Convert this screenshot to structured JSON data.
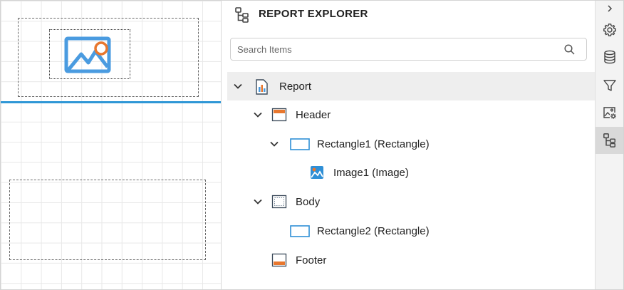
{
  "explorer": {
    "title": "REPORT EXPLORER",
    "search_placeholder": "Search Items",
    "tree": [
      {
        "label": "Report",
        "icon": "report-icon",
        "expanded": true,
        "selected": true
      },
      {
        "label": "Header",
        "icon": "header-band-icon",
        "expanded": true
      },
      {
        "label": "Rectangle1 (Rectangle)",
        "icon": "rectangle-icon",
        "expanded": true
      },
      {
        "label": "Image1 (Image)",
        "icon": "image-icon"
      },
      {
        "label": "Body",
        "icon": "body-band-icon",
        "expanded": true
      },
      {
        "label": "Rectangle2 (Rectangle)",
        "icon": "rectangle-icon"
      },
      {
        "label": "Footer",
        "icon": "footer-band-icon"
      }
    ]
  },
  "toolbar": {
    "items": [
      {
        "icon": "chevron-right-icon"
      },
      {
        "icon": "gear-icon"
      },
      {
        "icon": "database-icon"
      },
      {
        "icon": "filter-icon"
      },
      {
        "icon": "image-settings-icon"
      },
      {
        "icon": "report-explorer-icon",
        "active": true
      }
    ]
  },
  "colors": {
    "accent_blue": "#2f97d6",
    "icon_blue": "#4a9be0",
    "band_orange": "#e8772e",
    "selected_row": "#eeeeee"
  }
}
